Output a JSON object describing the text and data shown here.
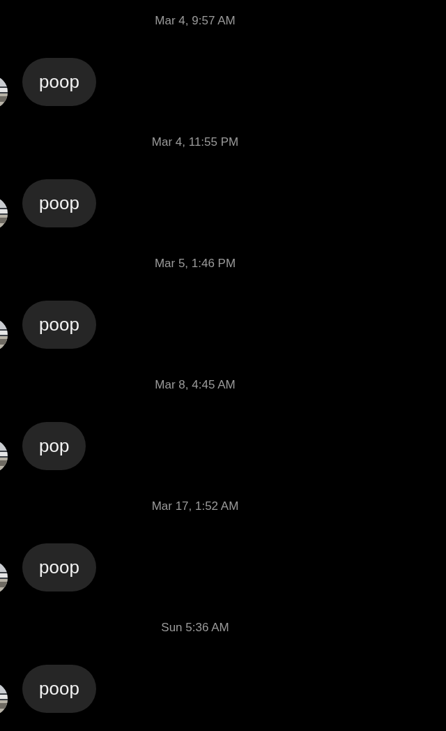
{
  "messages": [
    {
      "time": "Mar 4, 9:57 AM",
      "text": "poop"
    },
    {
      "time": "Mar 4, 11:55 PM",
      "text": "poop"
    },
    {
      "time": "Mar 5, 1:46 PM",
      "text": "poop"
    },
    {
      "time": "Mar 8, 4:45 AM",
      "text": "pop"
    },
    {
      "time": "Mar 17, 1:52 AM",
      "text": "poop"
    },
    {
      "time": "Sun 5:36 AM",
      "text": "poop"
    }
  ]
}
